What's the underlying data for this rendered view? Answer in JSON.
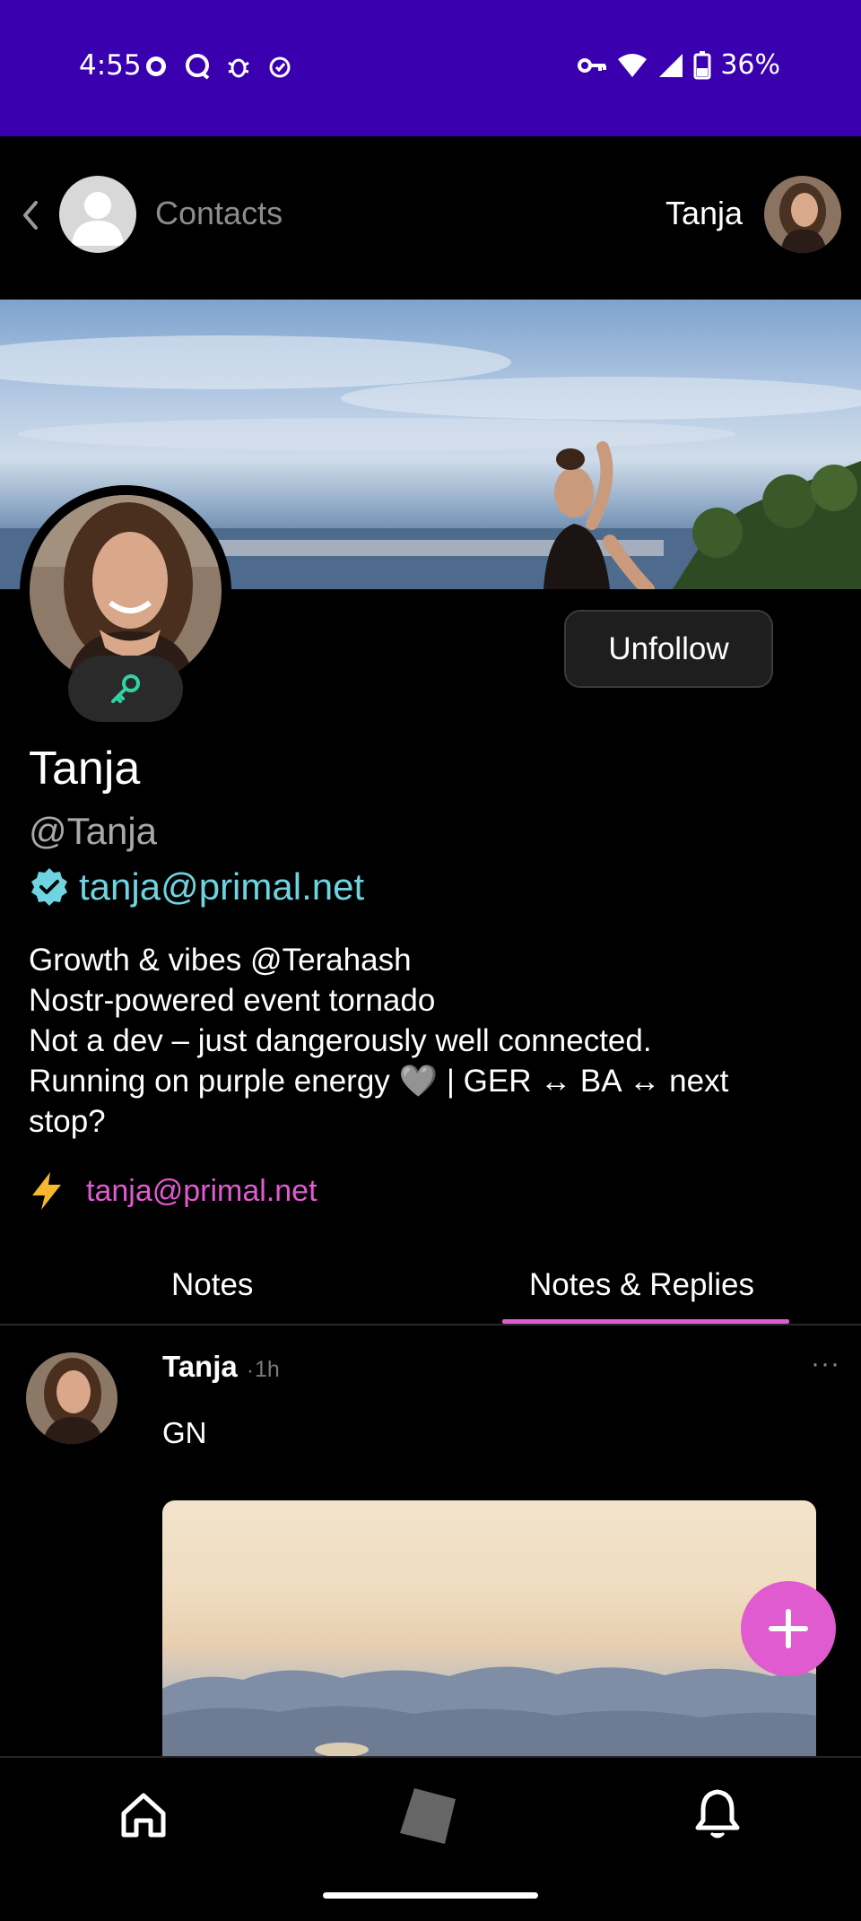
{
  "status_bar": {
    "time": "4:55",
    "battery": "36%",
    "background": "#3a00b0"
  },
  "top_nav": {
    "contacts_label": "Contacts",
    "profile_name": "Tanja"
  },
  "profile": {
    "display_name": "Tanja",
    "handle": "@Tanja",
    "nip05": "tanja@primal.net",
    "follow_button": "Unfollow",
    "bio_lines": [
      "Growth & vibes @Terahash",
      "Nostr-powered event tornado",
      "Not a dev – just dangerously well connected.",
      "Running on purple energy 🩶 | GER ↔ BA ↔ next",
      "stop?"
    ],
    "lightning_address": "tanja@primal.net"
  },
  "tabs": [
    {
      "label": "Notes",
      "active": false
    },
    {
      "label": "Notes & Replies",
      "active": true
    }
  ],
  "note": {
    "author": "Tanja",
    "separator": "·",
    "time": "1h",
    "more": "···",
    "text": "GN"
  },
  "colors": {
    "accent": "#e05ad0",
    "verified": "#6ed4e0",
    "key": "#2fd3a4",
    "lightning": "#f5b82e"
  },
  "icons": {
    "back": "chevron-left-icon",
    "key": "key-icon",
    "verified": "verified-badge-icon",
    "lightning": "lightning-icon",
    "compose": "plus-icon",
    "home": "home-icon",
    "explore": "cube-icon",
    "notifications": "bell-icon"
  }
}
